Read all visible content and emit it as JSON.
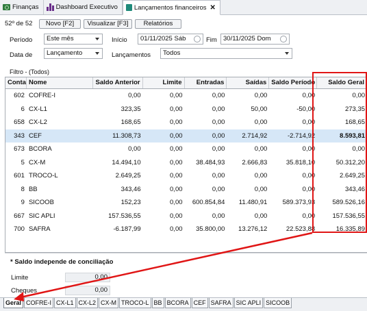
{
  "tabs": [
    {
      "label": "Finanças",
      "icon": "money-icon"
    },
    {
      "label": "Dashboard Executivo",
      "icon": "bar-chart-icon"
    },
    {
      "label": "Lançamentos financeiros",
      "icon": "book-icon",
      "active": true
    }
  ],
  "toolbar": {
    "record_count": "52º de 52",
    "new_label": "Novo [F2]",
    "view_label": "Visualizar [F3]",
    "reports_label": "Relatórios"
  },
  "filters": {
    "period_label": "Período",
    "period_value": "Este mês",
    "start_label": "Início",
    "start_value": "01/11/2025 Sáb",
    "end_label": "Fim",
    "end_value": "30/11/2025 Dom",
    "date_label": "Data de",
    "date_value": "Lançamento",
    "entries_label": "Lançamentos",
    "entries_value": "Todos",
    "filter_caption": "Filtro - (Todos)"
  },
  "grid": {
    "columns": [
      "Conta",
      "Nome",
      "Saldo Anterior",
      "Limite",
      "Entradas",
      "Saídas",
      "Saldo Período",
      "Saldo Geral"
    ],
    "rows": [
      [
        "602",
        "COFRE-I",
        "0,00",
        "0,00",
        "0,00",
        "0,00",
        "0,00",
        "0,00"
      ],
      [
        "6",
        "CX-L1",
        "323,35",
        "0,00",
        "0,00",
        "50,00",
        "-50,00",
        "273,35"
      ],
      [
        "658",
        "CX-L2",
        "168,65",
        "0,00",
        "0,00",
        "0,00",
        "0,00",
        "168,65"
      ],
      [
        "343",
        "CEF",
        "11.308,73",
        "0,00",
        "0,00",
        "2.714,92",
        "-2.714,92",
        "8.593,81"
      ],
      [
        "673",
        "BCORA",
        "0,00",
        "0,00",
        "0,00",
        "0,00",
        "0,00",
        "0,00"
      ],
      [
        "5",
        "CX-M",
        "14.494,10",
        "0,00",
        "38.484,93",
        "2.666,83",
        "35.818,10",
        "50.312,20"
      ],
      [
        "601",
        "TROCO-L",
        "2.649,25",
        "0,00",
        "0,00",
        "0,00",
        "0,00",
        "2.649,25"
      ],
      [
        "8",
        "BB",
        "343,46",
        "0,00",
        "0,00",
        "0,00",
        "0,00",
        "343,46"
      ],
      [
        "9",
        "SICOOB",
        "152,23",
        "0,00",
        "600.854,84",
        "11.480,91",
        "589.373,93",
        "589.526,16"
      ],
      [
        "667",
        "SIC APLI",
        "157.536,55",
        "0,00",
        "0,00",
        "0,00",
        "0,00",
        "157.536,55"
      ],
      [
        "700",
        "SAFRA",
        "-6.187,99",
        "0,00",
        "35.800,00",
        "13.276,12",
        "22.523,88",
        "16.335,89"
      ]
    ],
    "selected_row": 3
  },
  "saldo": {
    "note": "* Saldo independe de conciliação",
    "limit_label": "Limite",
    "limit_value": "0,00",
    "checks_label": "Cheques",
    "checks_value": "0,00"
  },
  "bottom_tabs": [
    "Geral",
    "COFRE-I",
    "CX-L1",
    "CX-L2",
    "CX-M",
    "TROCO-L",
    "BB",
    "BCORA",
    "CEF",
    "SAFRA",
    "SIC APLI",
    "SICOOB"
  ],
  "colors": {
    "highlight": "#e01515",
    "selected_row": "#d6e7f7"
  }
}
